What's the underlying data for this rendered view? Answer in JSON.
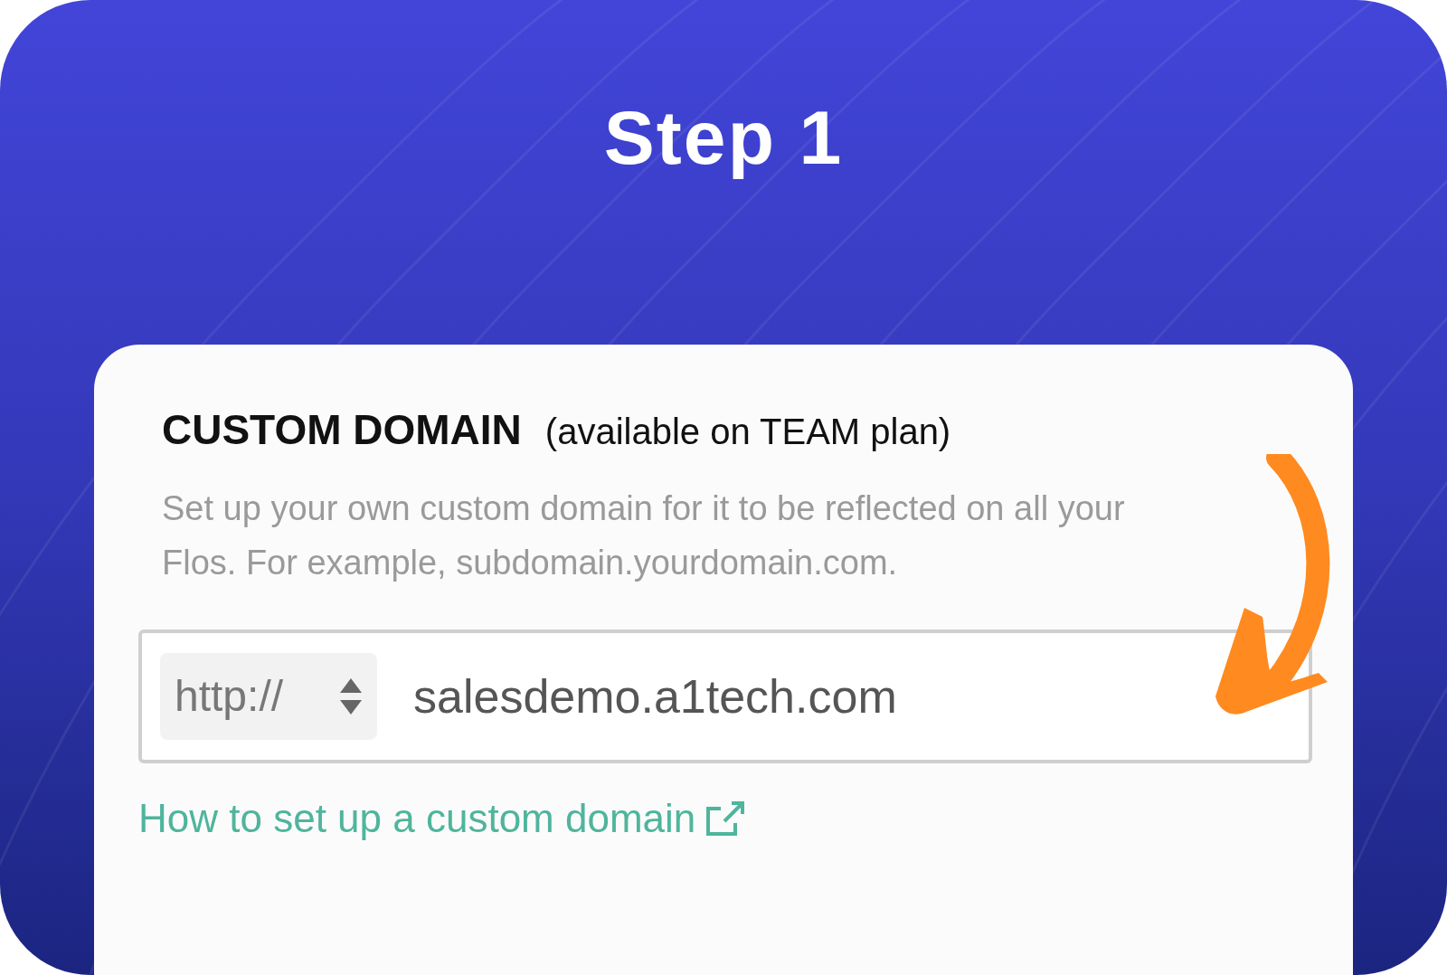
{
  "title": "Step 1",
  "section": {
    "heading": "CUSTOM DOMAIN",
    "note": "(available on TEAM plan)",
    "description": "Set up your own custom domain for it to be reflected on all your Flos. For example, subdomain.yourdomain.com.",
    "protocol_select": {
      "value": "http://"
    },
    "domain_field": {
      "value": "salesdemo.a1tech.com"
    },
    "help_link": "How to set up a custom domain"
  }
}
